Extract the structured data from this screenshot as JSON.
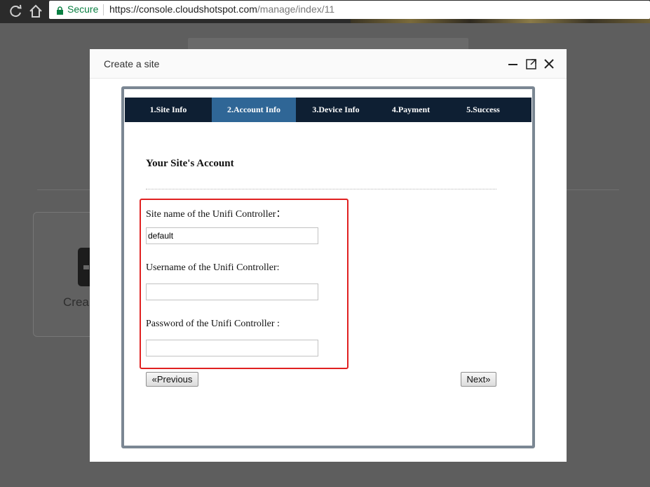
{
  "browser": {
    "secure_label": "Secure",
    "url_host": "https://console.cloudshotspot.com",
    "url_path": "/manage/index/11"
  },
  "background": {
    "card_label": "Crea"
  },
  "modal": {
    "title": "Create a site",
    "steps": [
      {
        "label": "1.Site Info",
        "active": false
      },
      {
        "label": "2.Account Info",
        "active": true
      },
      {
        "label": "3.Device Info",
        "active": false
      },
      {
        "label": "4.Payment",
        "active": false
      },
      {
        "label": "5.Success",
        "active": false
      }
    ],
    "section_title": "Your Site's Account",
    "fields": {
      "site_name_label": "Site name of the Unifi Controller：",
      "site_name_value": "default",
      "username_label": "Username of the Unifi Controller:",
      "username_value": "",
      "password_label": "Password of the Unifi Controller :",
      "password_value": ""
    },
    "buttons": {
      "previous": "«Previous",
      "next": "Next»"
    }
  },
  "colors": {
    "nav_bar": "#0e1f33",
    "active_step": "#2f6696",
    "highlight_border": "#e02020",
    "frame_border": "#7b8793",
    "secure_green": "#0b8043"
  },
  "icons": [
    "reload-icon",
    "home-icon",
    "lock-icon",
    "minimize-icon",
    "maximize-icon",
    "close-icon"
  ]
}
